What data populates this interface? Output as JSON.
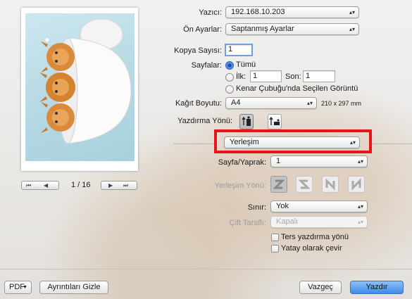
{
  "printer": {
    "label": "Yazıcı:",
    "value": "192.168.10.203"
  },
  "presets": {
    "label": "Ön Ayarlar:",
    "value": "Saptanmış Ayarlar"
  },
  "copies": {
    "label": "Kopya Sayısı:",
    "value": "1"
  },
  "pages": {
    "label": "Sayfalar:",
    "all_label": "Tümü",
    "from_label": "İlk:",
    "from_value": "1",
    "to_label": "Son:",
    "to_value": "1",
    "selection_label": "Kenar Çubuğu'nda Seçilen Görüntü"
  },
  "paper_size": {
    "label": "Kağıt Boyutu:",
    "value": "A4",
    "dimensions": "210 x 297 mm"
  },
  "orientation": {
    "label": "Yazdırma Yönü:"
  },
  "section_popup": {
    "value": "Yerleşim"
  },
  "layout": {
    "pages_per_sheet_label": "Sayfa/Yaprak:",
    "pages_per_sheet_value": "1",
    "direction_label": "Yerleşim Yönü:",
    "border_label": "Sınır:",
    "border_value": "Yok",
    "two_sided_label": "Çift Taraflı:",
    "two_sided_value": "Kapalı",
    "reverse_label": "Ters yazdırma yönü",
    "flip_label": "Yatay olarak çevir"
  },
  "preview": {
    "page_current": "1",
    "page_total": "16",
    "page_text": "1 / 16"
  },
  "footer": {
    "pdf_label": "PDF",
    "hide_details_label": "Ayrıntıları Gizle",
    "cancel_label": "Vazgeç",
    "print_label": "Yazdır"
  },
  "colors": {
    "highlight": "#e8141b",
    "primary_button": "#3e8be8",
    "focus_ring": "#6ea0df"
  }
}
